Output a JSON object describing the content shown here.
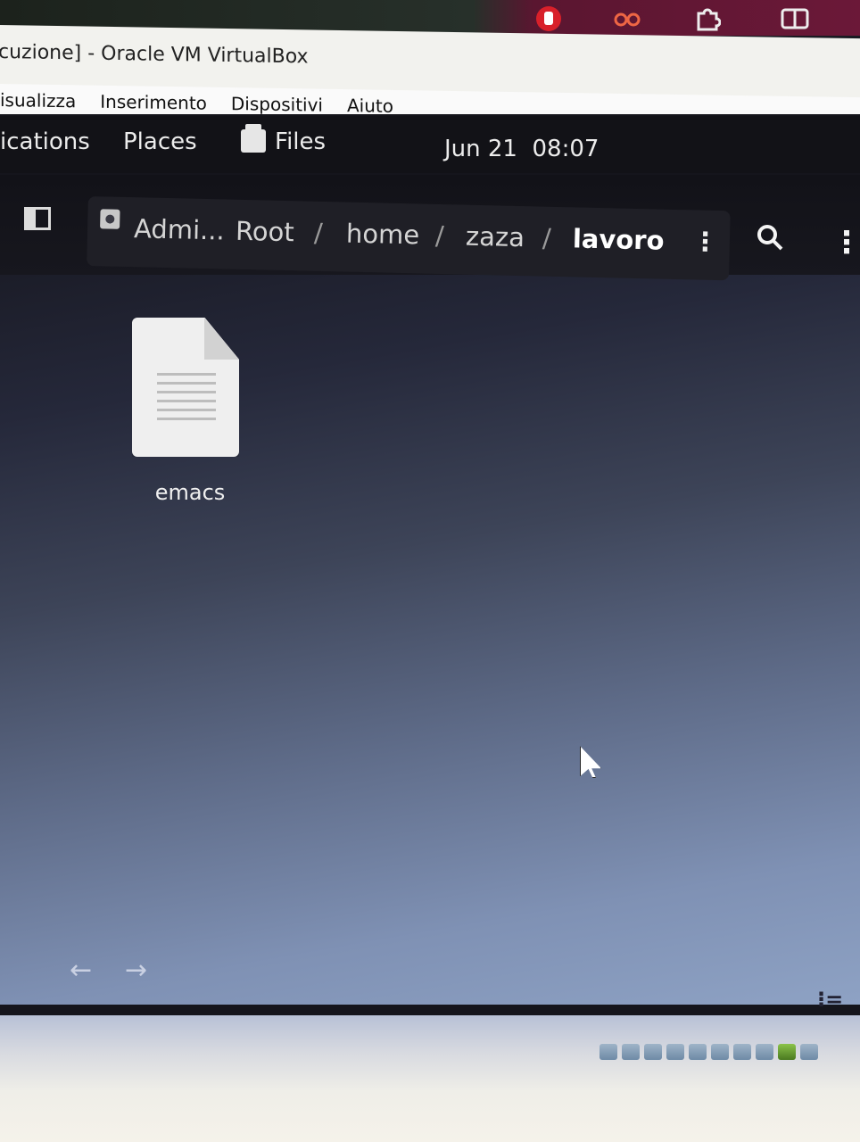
{
  "host": {
    "top_icons": [
      "hand-icon",
      "glasses-icon",
      "puzzle-icon",
      "split-window-icon"
    ]
  },
  "window": {
    "title": "cuzione] - Oracle VM VirtualBox"
  },
  "menu": [
    "isualizza",
    "Inserimento",
    "Dispositivi",
    "Aiuto"
  ],
  "gnome_bar": {
    "activities": "ications",
    "places": "Places",
    "app": "Files",
    "clock": "Jun 21  08:07"
  },
  "files": {
    "path": {
      "drive": "Admi...",
      "segments": [
        "Root",
        "home",
        "zaza",
        "lavoro"
      ],
      "separator": "/"
    },
    "items": [
      {
        "name": "emacs",
        "icon": "text-document-icon"
      }
    ],
    "nav_back": "←",
    "nav_forward": "→",
    "view_toggle": "⁝="
  },
  "colors": {
    "accent_red": "#d8202a",
    "dark_bg": "#15151c"
  }
}
